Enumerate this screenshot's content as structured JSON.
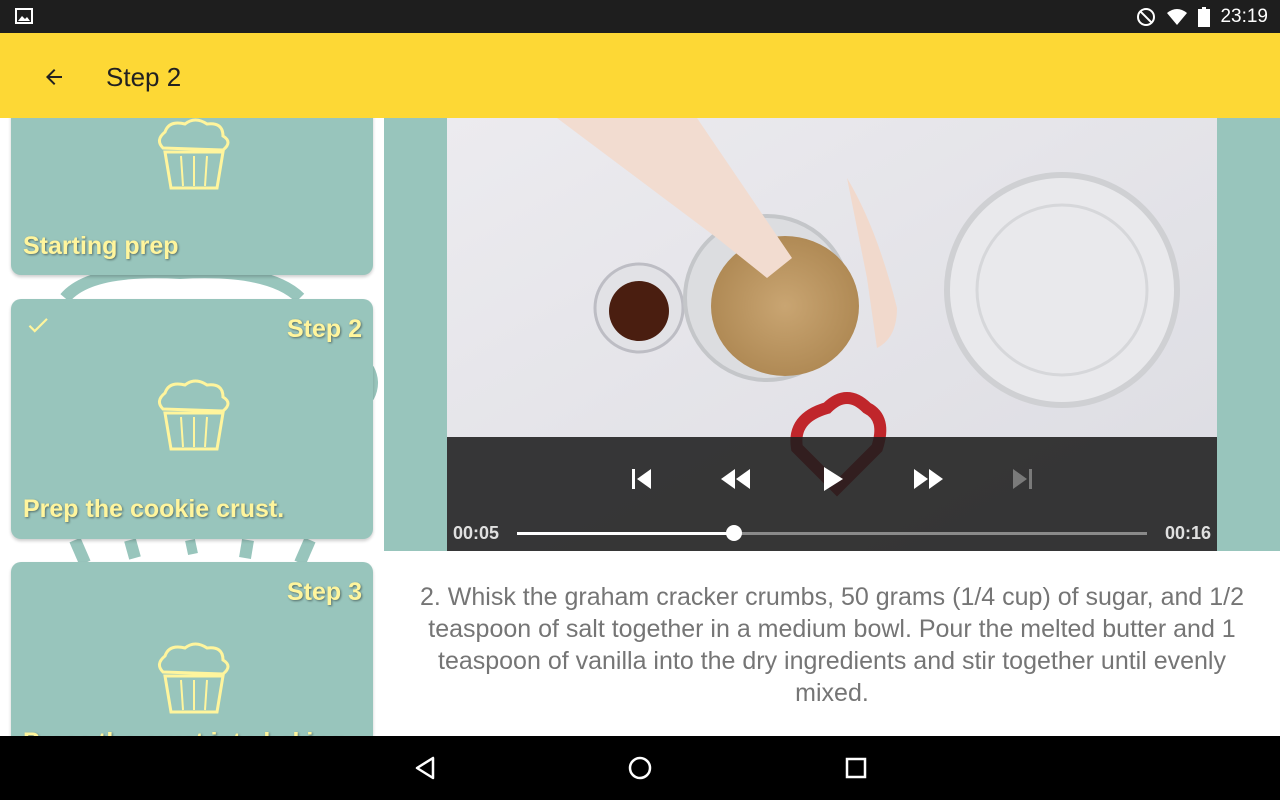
{
  "status_bar": {
    "time": "23:19",
    "icons": [
      "gallery-icon",
      "do-not-disturb-icon",
      "wifi-icon",
      "battery-icon"
    ]
  },
  "app_bar": {
    "title": "Step 2",
    "background_color": "#fdd835",
    "back_icon": "arrow-back-icon"
  },
  "steps": [
    {
      "number": "",
      "description": "Starting prep",
      "selected": false
    },
    {
      "number": "Step 2",
      "description": "Prep the cookie crust.",
      "selected": true,
      "checked": true
    },
    {
      "number": "Step 3",
      "description": "Press the crust into baking",
      "selected": false
    }
  ],
  "colors": {
    "card": "#98c5bc",
    "card_text": "#fff59d",
    "accent": "#fdd835"
  },
  "video": {
    "current_time": "00:05",
    "duration": "00:16",
    "progress": 0.345,
    "controls": [
      "skip-previous-icon",
      "rewind-icon",
      "play-icon",
      "fast-forward-icon",
      "skip-next-icon"
    ]
  },
  "instruction": {
    "text": "2. Whisk the graham cracker crumbs, 50 grams (1/4 cup) of sugar, and 1/2 teaspoon of salt together in a medium bowl. Pour the melted butter and 1 teaspoon of vanilla into the dry ingredients and stir together until evenly mixed."
  },
  "nav_bar": {
    "buttons": [
      "back-triangle-icon",
      "home-circle-icon",
      "recents-square-icon"
    ]
  }
}
